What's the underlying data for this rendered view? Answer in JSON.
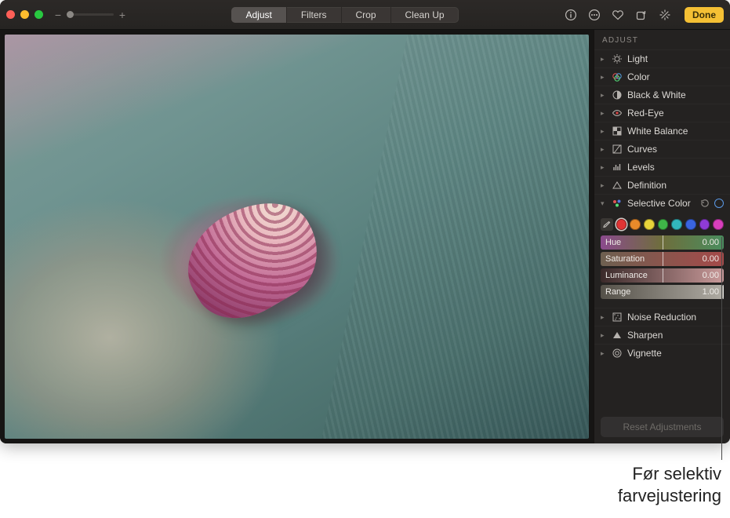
{
  "toolbar": {
    "tabs": [
      "Adjust",
      "Filters",
      "Crop",
      "Clean Up"
    ],
    "active_tab_index": 0,
    "done_label": "Done",
    "icons": [
      "info-circle",
      "ellipsis-circle",
      "heart",
      "add-square",
      "expand-arrows"
    ]
  },
  "panel": {
    "title": "ADJUST",
    "sections": [
      {
        "icon": "sun",
        "label": "Light",
        "expanded": false
      },
      {
        "icon": "rings",
        "label": "Color",
        "expanded": false
      },
      {
        "icon": "halfcircle",
        "label": "Black & White",
        "expanded": false
      },
      {
        "icon": "eye",
        "label": "Red-Eye",
        "expanded": false
      },
      {
        "icon": "checker",
        "label": "White Balance",
        "expanded": false
      },
      {
        "icon": "curves",
        "label": "Curves",
        "expanded": false
      },
      {
        "icon": "levels",
        "label": "Levels",
        "expanded": false
      },
      {
        "icon": "triangle",
        "label": "Definition",
        "expanded": false
      },
      {
        "icon": "colordots",
        "label": "Selective Color",
        "expanded": true,
        "has_reset": true
      }
    ],
    "after_sections": [
      {
        "icon": "noise",
        "label": "Noise Reduction",
        "expanded": false
      },
      {
        "icon": "trianglef",
        "label": "Sharpen",
        "expanded": false
      },
      {
        "icon": "circleoff",
        "label": "Vignette",
        "expanded": false
      }
    ],
    "selective_color": {
      "swatches": [
        "#e03434",
        "#e88a2a",
        "#e8d43a",
        "#3fb648",
        "#32b7bd",
        "#3a64e0",
        "#8f3bd6",
        "#d83fbd"
      ],
      "selected_index": 0,
      "sliders": [
        {
          "name": "Hue",
          "class": "hue",
          "value": "0.00"
        },
        {
          "name": "Saturation",
          "class": "sat",
          "value": "0.00"
        },
        {
          "name": "Luminance",
          "class": "lum",
          "value": "0.00"
        },
        {
          "name": "Range",
          "class": "range",
          "value": "1.00"
        }
      ]
    },
    "reset_label": "Reset Adjustments"
  },
  "callout": {
    "line1": "Før selektiv",
    "line2": "farvejustering"
  }
}
